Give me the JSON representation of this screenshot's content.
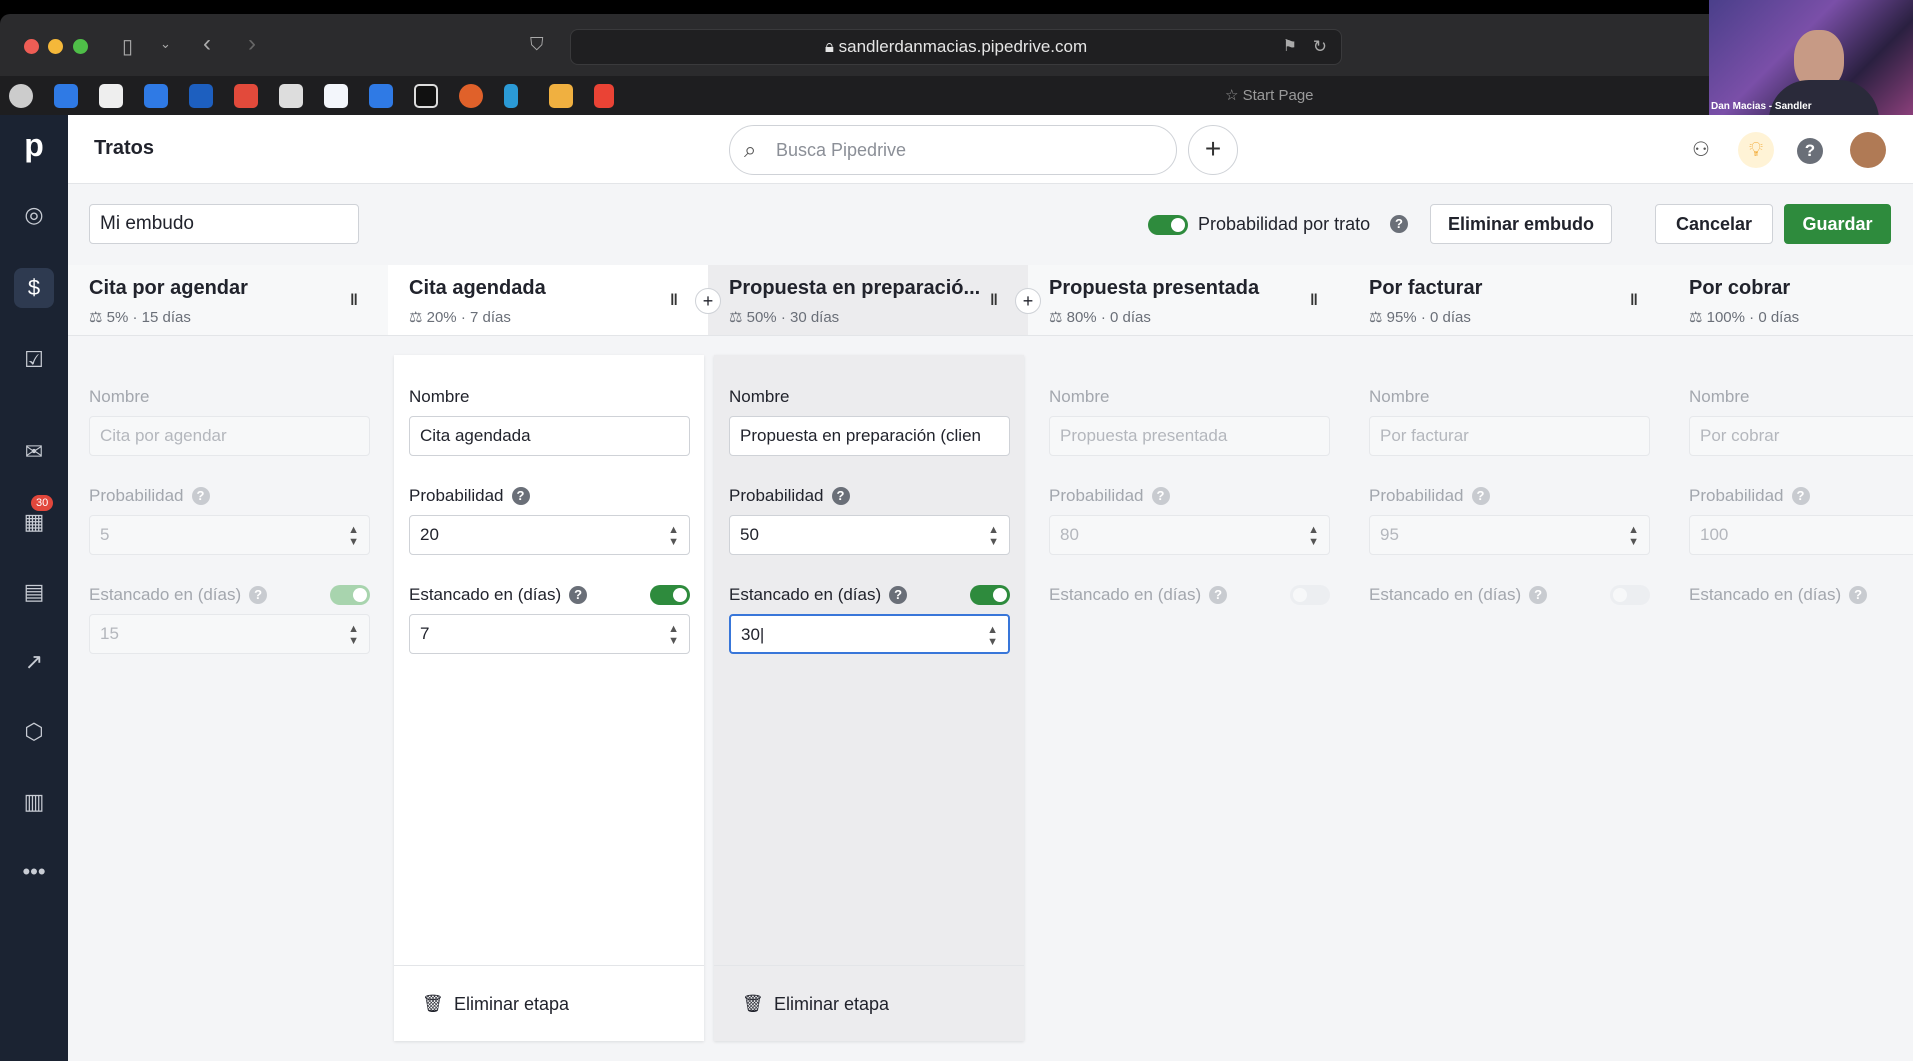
{
  "browser": {
    "url": "sandlerdanmacias.pipedrive.com",
    "start_page": "Start Page",
    "webcam_name": "Dan Macias - Sandler"
  },
  "app": {
    "title": "Tratos",
    "search_placeholder": "Busca Pipedrive",
    "notifications_badge": "30"
  },
  "toolbar": {
    "pipeline_name": "Mi embudo",
    "probability_label": "Probabilidad por trato",
    "probability_on": true,
    "delete_pipeline": "Eliminar embudo",
    "cancel": "Cancelar",
    "save": "Guardar",
    "save_color": "#2e8b3d"
  },
  "labels": {
    "name": "Nombre",
    "probability": "Probabilidad",
    "rotting": "Estancado en (días)",
    "delete_stage": "Eliminar etapa"
  },
  "stages": [
    {
      "name": "Cita por agendar",
      "meta": "5% · 15 días",
      "field_name": "Cita por agendar",
      "probability": "5",
      "rotting": "15",
      "rotting_on": true,
      "state": "dim"
    },
    {
      "name": "Cita agendada",
      "meta": "20% · 7 días",
      "field_name": "Cita agendada",
      "probability": "20",
      "rotting": "7",
      "rotting_on": true,
      "state": "active"
    },
    {
      "name": "Propuesta en preparació...",
      "meta": "50% · 30 días",
      "field_name": "Propuesta en preparación (clien",
      "probability": "50",
      "rotting": "30",
      "rotting_on": true,
      "state": "sel"
    },
    {
      "name": "Propuesta presentada",
      "meta": "80% · 0 días",
      "field_name": "Propuesta presentada",
      "probability": "80",
      "rotting": "",
      "rotting_on": false,
      "state": "dim"
    },
    {
      "name": "Por facturar",
      "meta": "95% · 0 días",
      "field_name": "Por facturar",
      "probability": "95",
      "rotting": "",
      "rotting_on": false,
      "state": "dim"
    },
    {
      "name": "Por cobrar",
      "meta": "100% · 0 días",
      "field_name": "Por cobrar",
      "probability": "100",
      "rotting": "",
      "rotting_on": false,
      "state": "dim"
    }
  ]
}
